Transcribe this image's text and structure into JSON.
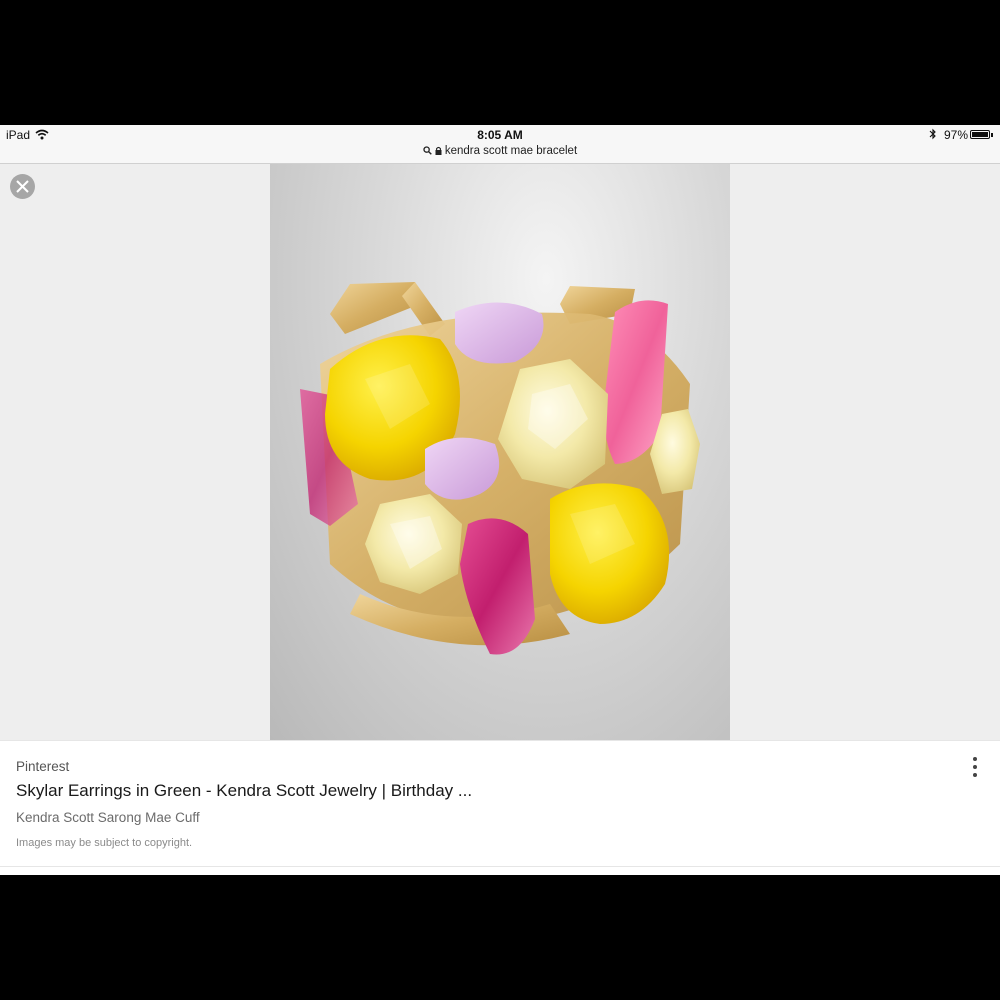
{
  "status_bar": {
    "device": "iPad",
    "time": "8:05 AM",
    "url": "kendra scott mae bracelet",
    "battery": "97%",
    "battery_level": 0.97
  },
  "image_viewer": {
    "close_icon": "close-icon",
    "photo_alt": "Kendra Scott Sarong Mae Cuff"
  },
  "result": {
    "source": "Pinterest",
    "title": "Skylar Earrings in Green - Kendra Scott Jewelry | Birthday ...",
    "subtitle": "Kendra Scott Sarong Mae Cuff",
    "copyright": "Images may be subject to copyright.",
    "more_icon": "more-vertical-icon"
  },
  "colors": {
    "letterbox": "#000000",
    "viewer_background": "#eeeeee",
    "close_button": "#a6a6a6"
  }
}
